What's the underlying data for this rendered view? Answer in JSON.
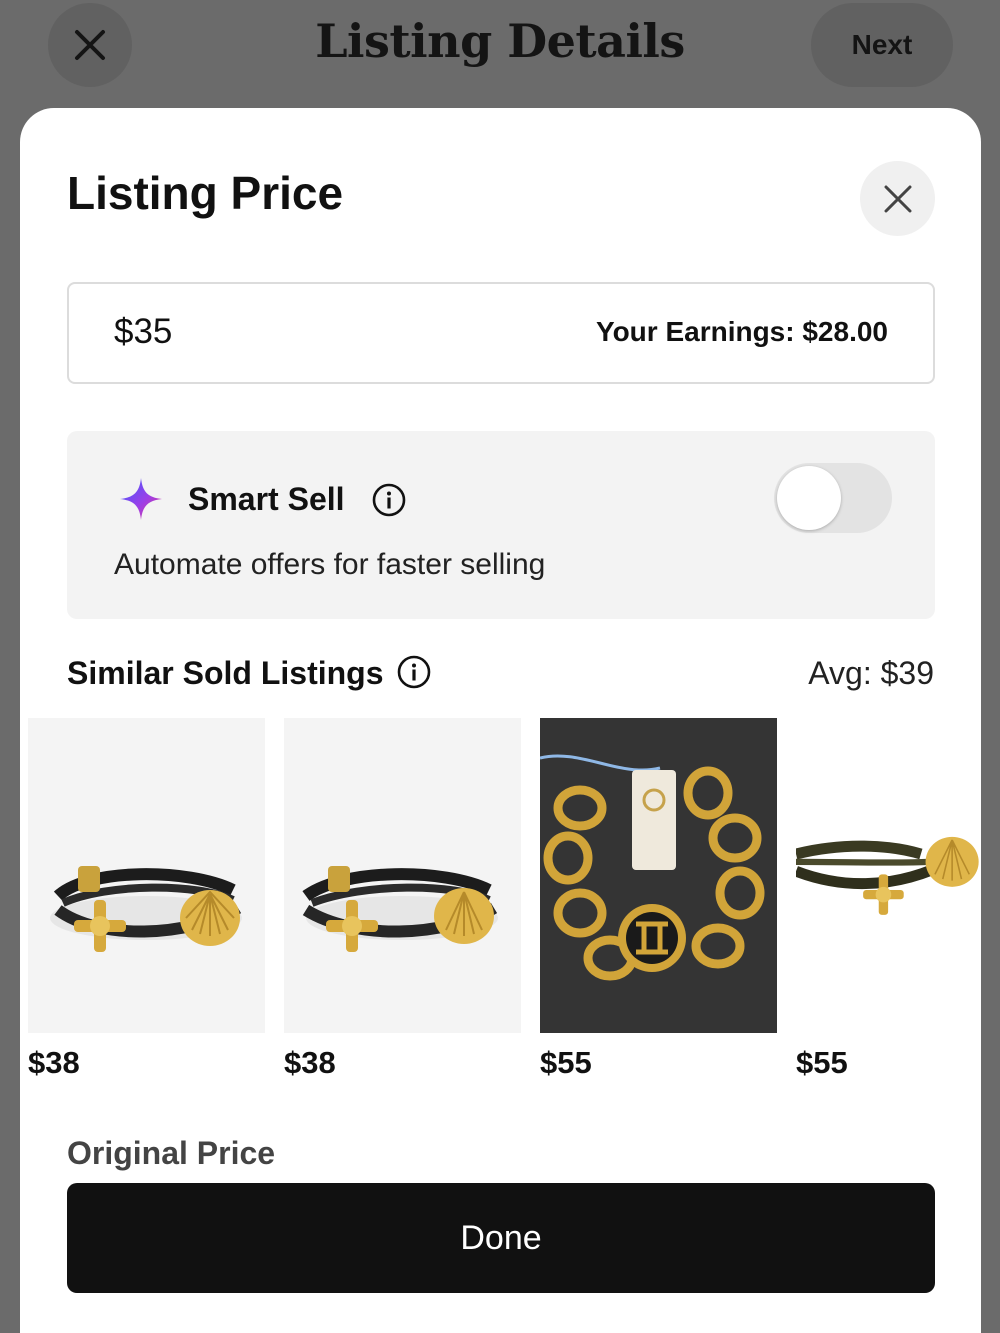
{
  "header": {
    "title": "Listing Details",
    "close_icon": "close-icon",
    "next_label": "Next"
  },
  "sheet": {
    "title": "Listing Price",
    "close_icon": "close-icon"
  },
  "price": {
    "value": "$35",
    "earnings": "Your Earnings: $28.00"
  },
  "smart_sell": {
    "icon": "sparkle-icon",
    "label": "Smart Sell",
    "info_icon": "info-icon",
    "description": "Automate offers for faster selling",
    "enabled": false
  },
  "similar": {
    "title": "Similar Sold Listings",
    "info_icon": "info-icon",
    "avg": "Avg: $39",
    "items": [
      {
        "price": "$38"
      },
      {
        "price": "$38"
      },
      {
        "price": "$55"
      },
      {
        "price": "$55"
      }
    ]
  },
  "original_price_label": "Original Price",
  "done_label": "Done",
  "colors": {
    "overlay": "#6b6b6b",
    "sheet": "#ffffff",
    "button": "#111111",
    "toggle_off": "#e3e3e3",
    "sparkle_start": "#3b5bff",
    "sparkle_end": "#e0358f"
  }
}
